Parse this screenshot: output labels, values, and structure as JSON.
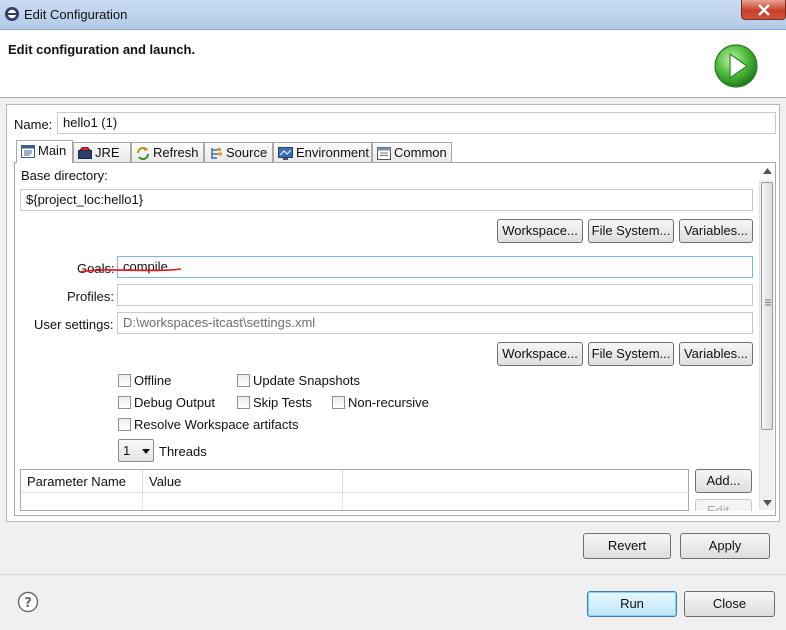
{
  "window": {
    "title": "Edit Configuration"
  },
  "header": {
    "title": "Edit configuration and launch."
  },
  "name_field": {
    "label": "Name:",
    "value": "hello1 (1)"
  },
  "tabs": [
    {
      "label": "Main",
      "icon": "main-icon"
    },
    {
      "label": "JRE",
      "icon": "jre-icon"
    },
    {
      "label": "Refresh",
      "icon": "refresh-icon"
    },
    {
      "label": "Source",
      "icon": "source-icon"
    },
    {
      "label": "Environment",
      "icon": "environment-icon"
    },
    {
      "label": "Common",
      "icon": "common-icon"
    }
  ],
  "main_tab": {
    "base_dir_label": "Base directory:",
    "base_dir_value": "${project_loc:hello1}",
    "workspace_btn": "Workspace...",
    "filesystem_btn": "File System...",
    "variables_btn": "Variables...",
    "goals_label": "Goals:",
    "goals_value": "compile",
    "profiles_label": "Profiles:",
    "profiles_value": "",
    "user_settings_label": "User settings:",
    "user_settings_value": "D:\\workspaces-itcast\\settings.xml",
    "checkboxes": {
      "offline": "Offline",
      "update_snapshots": "Update Snapshots",
      "debug_output": "Debug Output",
      "skip_tests": "Skip Tests",
      "non_recursive": "Non-recursive",
      "resolve_workspace": "Resolve Workspace artifacts"
    },
    "threads_value": "1",
    "threads_label": "Threads",
    "table_headers": [
      "Parameter Name",
      "Value"
    ],
    "add_btn": "Add...",
    "edit_btn": "Edit..."
  },
  "buttons": {
    "revert": "Revert",
    "apply": "Apply",
    "run": "Run",
    "close": "Close"
  },
  "help_icon": "help-icon",
  "colors": {
    "annotation_red": "#e2141c",
    "run_green": "#3aa83a"
  }
}
